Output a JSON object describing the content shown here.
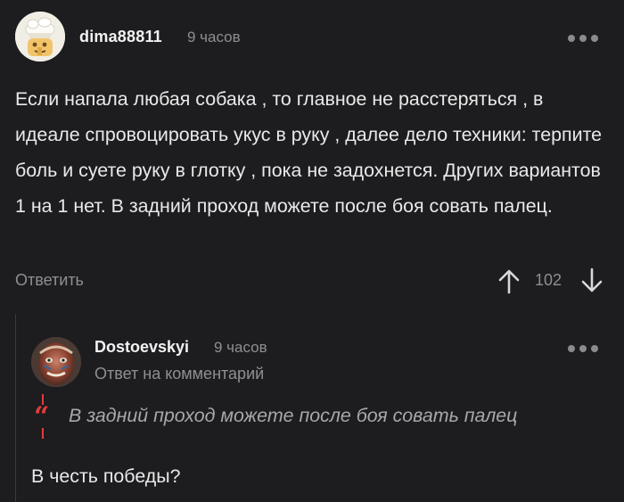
{
  "comment": {
    "username": "dima88811",
    "time": "9 часов",
    "text": "Если напала любая собака , то главное не расстеряться , в идеале спровоцировать укус в руку , далее дело техники: терпите боль и суете руку в глотку , пока не задохнется. Других вариантов 1 на 1 нет. В задний проход можете после боя совать палец.",
    "reply_label": "Ответить",
    "rating": "102"
  },
  "reply": {
    "username": "Dostoevskyi",
    "time": "9 часов",
    "reply_to_label": "Ответ на комментарий",
    "quote": "В задний проход можете после боя совать палец",
    "text": "В честь победы?"
  },
  "icons": {
    "more": "more-dots-icon",
    "upvote": "arrow-up-icon",
    "downvote": "arrow-down-icon",
    "quote": "quote-icon"
  },
  "colors": {
    "background": "#1d1d1f",
    "accent": "#e23c3c",
    "muted": "#8e8f93"
  }
}
